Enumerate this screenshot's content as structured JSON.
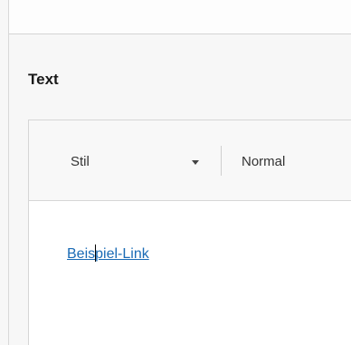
{
  "field": {
    "label": "Text"
  },
  "toolbar": {
    "style_combo_label": "Stil",
    "format_value": "Normal"
  },
  "content": {
    "link_text_before_cursor": "Beis",
    "link_text_after_cursor": "piel-Link"
  },
  "colors": {
    "link": "#1a6bb5",
    "border": "#d6d6d6",
    "toolbar_bg": "#f8f8f8",
    "page_bg": "#f7f7f7"
  }
}
